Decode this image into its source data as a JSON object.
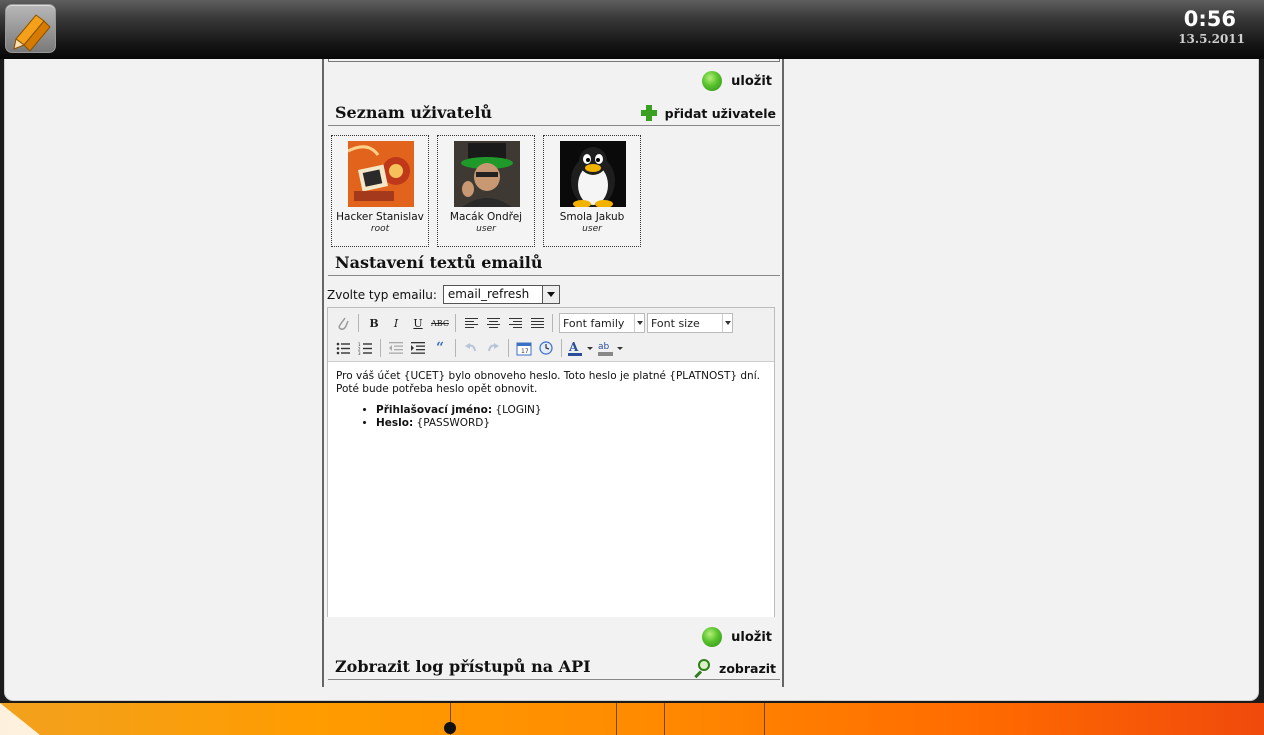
{
  "header": {
    "time": "0:56",
    "date": "13.5.2011"
  },
  "actions": {
    "save_label": "uložit"
  },
  "users_section": {
    "title": "Seznam uživatelů",
    "add_label": "přidat uživatele",
    "users": [
      {
        "name": "Hacker Stanislav",
        "role": "root"
      },
      {
        "name": "Macák Ondřej",
        "role": "user"
      },
      {
        "name": "Smola Jakub",
        "role": "user"
      }
    ]
  },
  "email_section": {
    "title": "Nastavení textů emailů",
    "type_label": "Zvolte typ emailu:",
    "type_value": "email_refresh",
    "toolbar": {
      "font_family": "Font family",
      "font_size": "Font size"
    },
    "body_text": "Pro váš účet {UCET} bylo obnoveho heslo. Toto heslo je platné {PLATNOST} dní. Poté bude potřeba heslo opět obnovit.",
    "items": [
      {
        "label": "Přihlašovací jméno:",
        "value": "{LOGIN}"
      },
      {
        "label": "Heslo:",
        "value": "{PASSWORD}"
      }
    ]
  },
  "api_section": {
    "title": "Zobrazit log přístupů na API",
    "show_label": "zobrazit"
  }
}
